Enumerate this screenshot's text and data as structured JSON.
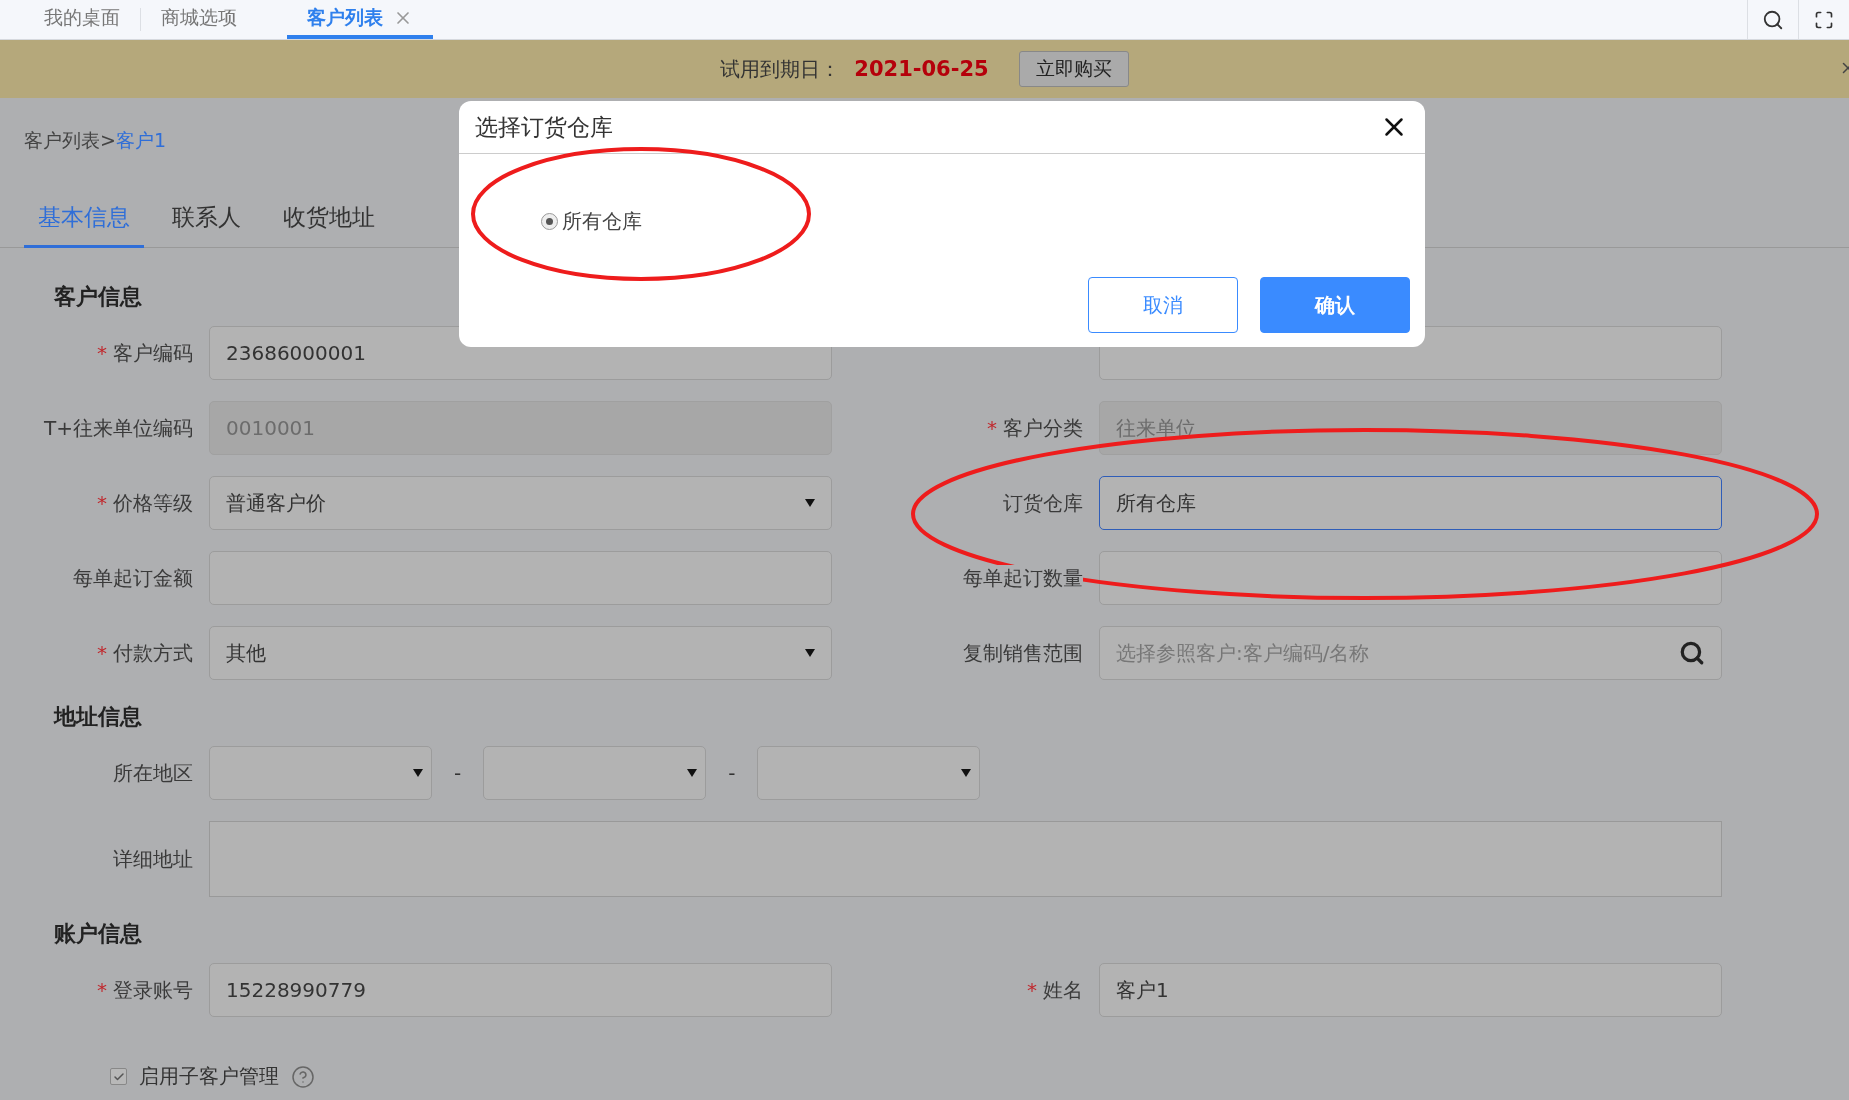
{
  "top_tabs": [
    {
      "label": "我的桌面",
      "selected": false,
      "closable": false
    },
    {
      "label": "商城选项",
      "selected": false,
      "closable": false
    },
    {
      "label": "客户列表",
      "selected": true,
      "closable": true
    }
  ],
  "banner": {
    "label": "试用到期日：",
    "date": "2021-06-25",
    "button": "立即购买"
  },
  "breadcrumb": {
    "parent": "客户列表>",
    "current": "客户1"
  },
  "tabs": [
    {
      "label": "基本信息",
      "selected": true
    },
    {
      "label": "联系人",
      "selected": false
    },
    {
      "label": "收货地址",
      "selected": false
    }
  ],
  "sections": [
    {
      "title": "客户信息",
      "fields": [
        {
          "kind": "input",
          "label": "客户编码",
          "required": true,
          "value": "23686000001",
          "disabled": false,
          "focused": false
        },
        {
          "kind": "input",
          "disabled": false,
          "focused": false
        },
        {
          "kind": "input",
          "label": "T+往来单位编码",
          "required": false,
          "value": "0010001",
          "disabled": true,
          "focused": false
        },
        {
          "kind": "input",
          "label": "客户分类",
          "required": true,
          "value": "往来单位",
          "disabled": true,
          "focused": false
        },
        {
          "kind": "select",
          "label": "价格等级",
          "required": true,
          "value": "普通客户价",
          "disabled": false,
          "focused": false
        },
        {
          "kind": "input",
          "label": "订货仓库",
          "required": false,
          "value": "所有仓库",
          "disabled": false,
          "focused": true
        },
        {
          "kind": "input",
          "label": "每单起订金额",
          "required": false,
          "disabled": false,
          "focused": false
        },
        {
          "kind": "input",
          "label": "每单起订数量",
          "required": false,
          "disabled": false,
          "focused": false
        },
        {
          "kind": "select",
          "label": "付款方式",
          "required": true,
          "value": "其他",
          "disabled": false,
          "focused": false
        },
        {
          "kind": "search",
          "label": "复制销售范围",
          "required": false,
          "placeholder": "选择参照客户:客户编码/名称",
          "disabled": false,
          "focused": false
        }
      ]
    },
    {
      "title": "地址信息",
      "fields": [
        {
          "kind": "region",
          "label": "所在地区",
          "required": false,
          "separators": [
            "-",
            "-"
          ]
        },
        {
          "kind": "textarea",
          "label": "详细地址",
          "required": false
        }
      ]
    },
    {
      "title": "账户信息",
      "fields": [
        {
          "kind": "input",
          "label": "登录账号",
          "required": true,
          "value": "15228990779",
          "disabled": false,
          "focused": false
        },
        {
          "kind": "input",
          "label": "姓名",
          "required": true,
          "value": "客户1",
          "disabled": false,
          "focused": false
        }
      ]
    }
  ],
  "required_mark": "*",
  "sub_customer": {
    "label": "启用子客户管理",
    "checked": true
  },
  "dialog": {
    "title": "选择订货仓库",
    "options": [
      {
        "label": "所有仓库",
        "selected": true
      }
    ],
    "buttons": [
      {
        "label": "取消",
        "kind": "secondary"
      },
      {
        "label": "确认",
        "kind": "primary"
      }
    ]
  }
}
